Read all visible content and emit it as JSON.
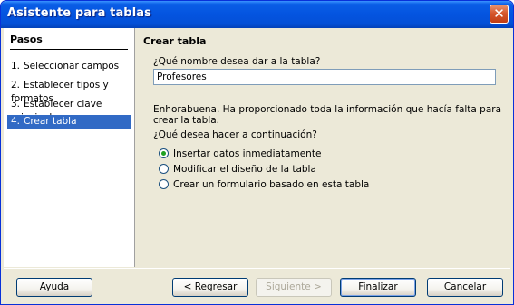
{
  "window": {
    "title": "Asistente para tablas"
  },
  "sidebar": {
    "heading": "Pasos",
    "steps": [
      {
        "num": "1.",
        "label": "Seleccionar campos"
      },
      {
        "num": "2.",
        "label": "Establecer tipos y formatos"
      },
      {
        "num": "3.",
        "label": "Establecer clave principal"
      },
      {
        "num": "4.",
        "label": "Crear tabla"
      }
    ]
  },
  "main": {
    "title": "Crear tabla",
    "name_question": "¿Qué nombre desea dar a la tabla?",
    "name_value": "Profesores",
    "congrats": "Enhorabuena. Ha proporcionado toda la información que hacía falta para crear la tabla.",
    "next_question": "¿Qué desea hacer a continuación?",
    "options": [
      {
        "label": "Insertar datos inmediatamente",
        "checked": true
      },
      {
        "label": "Modificar el diseño de la tabla",
        "checked": false
      },
      {
        "label": "Crear un formulario basado en esta tabla",
        "checked": false
      }
    ]
  },
  "buttons": {
    "help": "Ayuda",
    "back": "< Regresar",
    "next": "Siguiente >",
    "finish": "Finalizar",
    "cancel": "Cancelar"
  }
}
